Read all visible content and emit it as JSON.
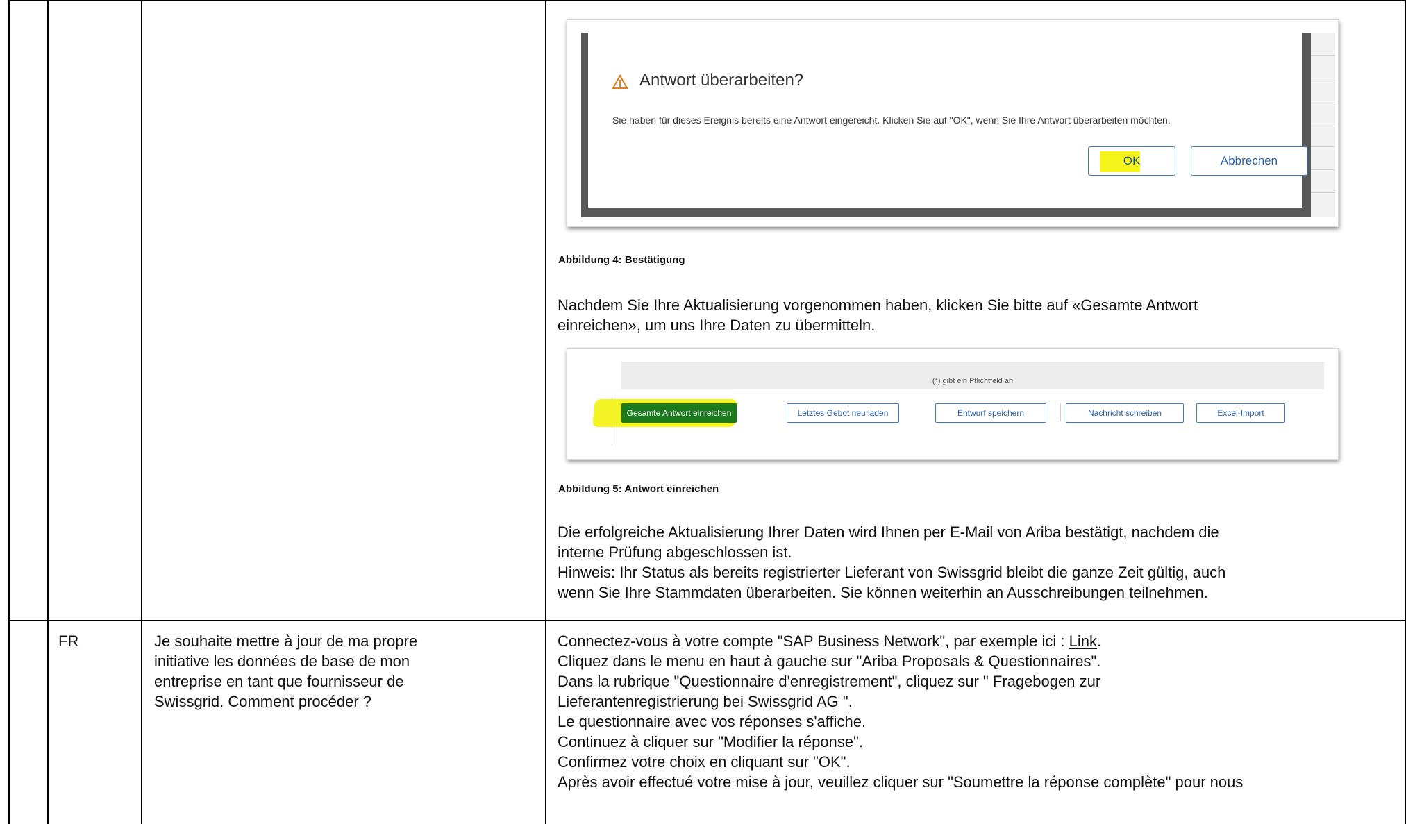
{
  "figure4": {
    "dialog_title": "Antwort überarbeiten?",
    "dialog_message": "Sie haben für dieses Ereignis bereits eine Antwort eingereicht. Klicken Sie auf \"OK\", wenn Sie Ihre Antwort überarbeiten möchten.",
    "ok_label": "OK",
    "cancel_label": "Abbrechen",
    "caption": "Abbildung 4: Bestätigung",
    "warning_icon": "warning-triangle-icon"
  },
  "para_after_fig4": [
    "Nachdem Sie Ihre Aktualisierung vorgenommen haben, klicken Sie bitte auf «Gesamte Antwort",
    "einreichen», um uns Ihre Daten zu übermitteln."
  ],
  "figure5": {
    "required_note": "(*) gibt ein Pflichtfeld an",
    "buttons": [
      "Gesamte Antwort einreichen",
      "Letztes Gebot neu laden",
      "Entwurf speichern",
      "Nachricht schreiben",
      "Excel-Import"
    ],
    "caption": "Abbildung 5: Antwort einreichen"
  },
  "para_after_fig5": [
    "Die erfolgreiche Aktualisierung Ihrer Daten wird Ihnen per E-Mail von Ariba bestätigt, nachdem die",
    "interne Prüfung abgeschlossen ist.",
    "Hinweis: Ihr Status als bereits registrierter Lieferant von Swissgrid bleibt die ganze Zeit gültig, auch",
    "wenn Sie Ihre Stammdaten überarbeiten. Sie können weiterhin an Ausschreibungen teilnehmen."
  ],
  "fr_row": {
    "lang": "FR",
    "question": [
      "Je souhaite mettre à jour de ma propre",
      "initiative les données de base de mon",
      "entreprise en tant que fournisseur de",
      "Swissgrid. Comment procéder ?"
    ],
    "answer_first": "Connectez-vous à votre compte \"SAP Business Network\", par exemple ici : ",
    "answer_link": "Link",
    "answer_first_end": ".",
    "answer": [
      "Cliquez dans le menu en haut à gauche sur \"Ariba Proposals & Questionnaires\".",
      "Dans la rubrique \"Questionnaire d'enregistrement\", cliquez sur \" Fragebogen zur",
      "Lieferantenregistrierung bei Swissgrid AG \".",
      "Le questionnaire avec vos réponses s'affiche.",
      "Continuez à cliquer sur \"Modifier la réponse\".",
      "Confirmez votre choix en cliquant sur \"OK\".",
      "Après avoir effectué votre mise à jour, veuillez cliquer sur \"Soumettre la réponse complète\" pour nous"
    ]
  }
}
